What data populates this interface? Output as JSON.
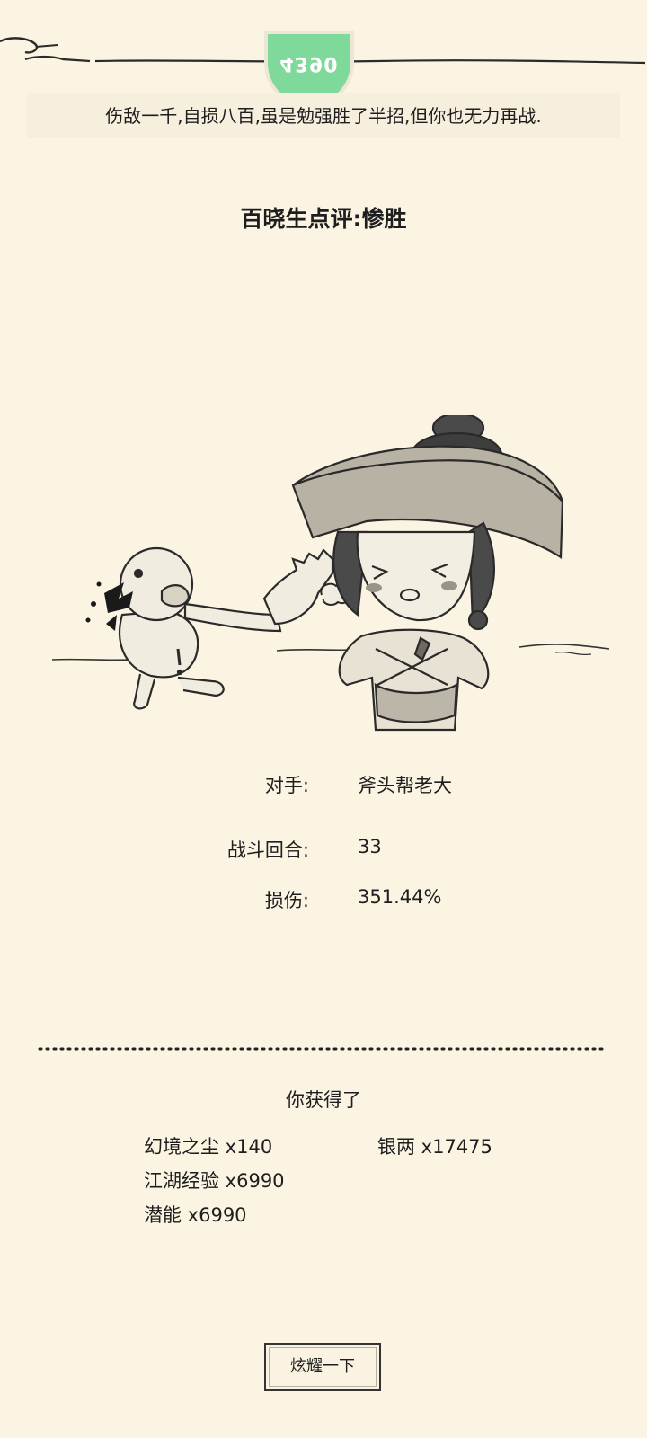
{
  "badge": {
    "text": "4390"
  },
  "battle_message": "伤敌一千,自损八百,虽是勉强胜了半招,但你也无力再战.",
  "comment": "百晓生点评:惨胜",
  "stats": [
    {
      "label": "对手:",
      "value": "斧头帮老大"
    },
    {
      "label": "战斗回合:",
      "value": "33"
    },
    {
      "label": "损伤:",
      "value": "351.44%"
    }
  ],
  "rewards": {
    "title": "你获得了",
    "items": [
      {
        "label": "幻境之尘 x140"
      },
      {
        "label": "银两 x17475"
      },
      {
        "label": "江湖经验 x6990"
      },
      {
        "label": "潜能 x6990"
      }
    ]
  },
  "share_button": "炫耀一下",
  "colors": {
    "background": "#fbf4e3",
    "badge": "#7ed99a",
    "text": "#1e1e1e"
  }
}
